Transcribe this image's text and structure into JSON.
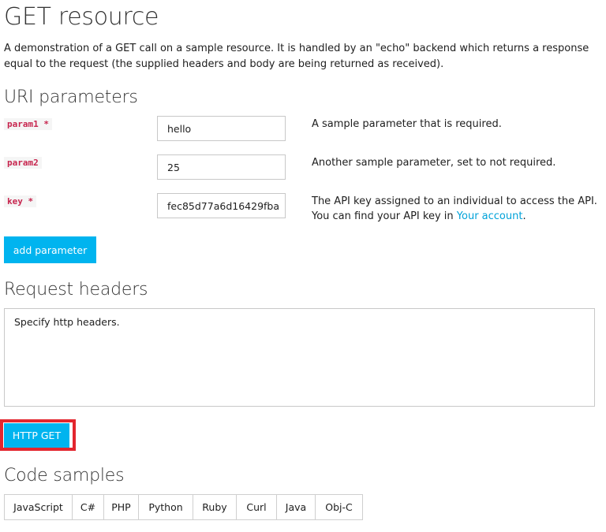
{
  "page": {
    "title": "GET resource",
    "description": "A demonstration of a GET call on a sample resource. It is handled by an \"echo\" backend which returns a response equal to the request (the supplied headers and body are being returned as received)."
  },
  "uri_parameters": {
    "heading": "URI parameters",
    "params": [
      {
        "name": "param1 *",
        "value": "hello",
        "description": "A sample parameter that is required."
      },
      {
        "name": "param2",
        "value": "25",
        "description": "Another sample parameter, set to not required."
      },
      {
        "name": "key *",
        "value": "fec85d77a6d16429fba",
        "description_prefix": "The API key assigned to an individual to access the API. You can find your API key in ",
        "description_link": "Your account",
        "description_suffix": "."
      }
    ],
    "add_button_label": "add parameter"
  },
  "request_headers": {
    "heading": "Request headers",
    "placeholder": "Specify http headers."
  },
  "send_button_label": "HTTP GET",
  "code_samples": {
    "heading": "Code samples",
    "tabs": [
      "JavaScript",
      "C#",
      "PHP",
      "Python",
      "Ruby",
      "Curl",
      "Java",
      "Obj-C"
    ]
  },
  "colors": {
    "accent": "#00b4ef",
    "link": "#00a2d9",
    "highlight_border": "#e3262e",
    "param_name": "#c7254e"
  }
}
